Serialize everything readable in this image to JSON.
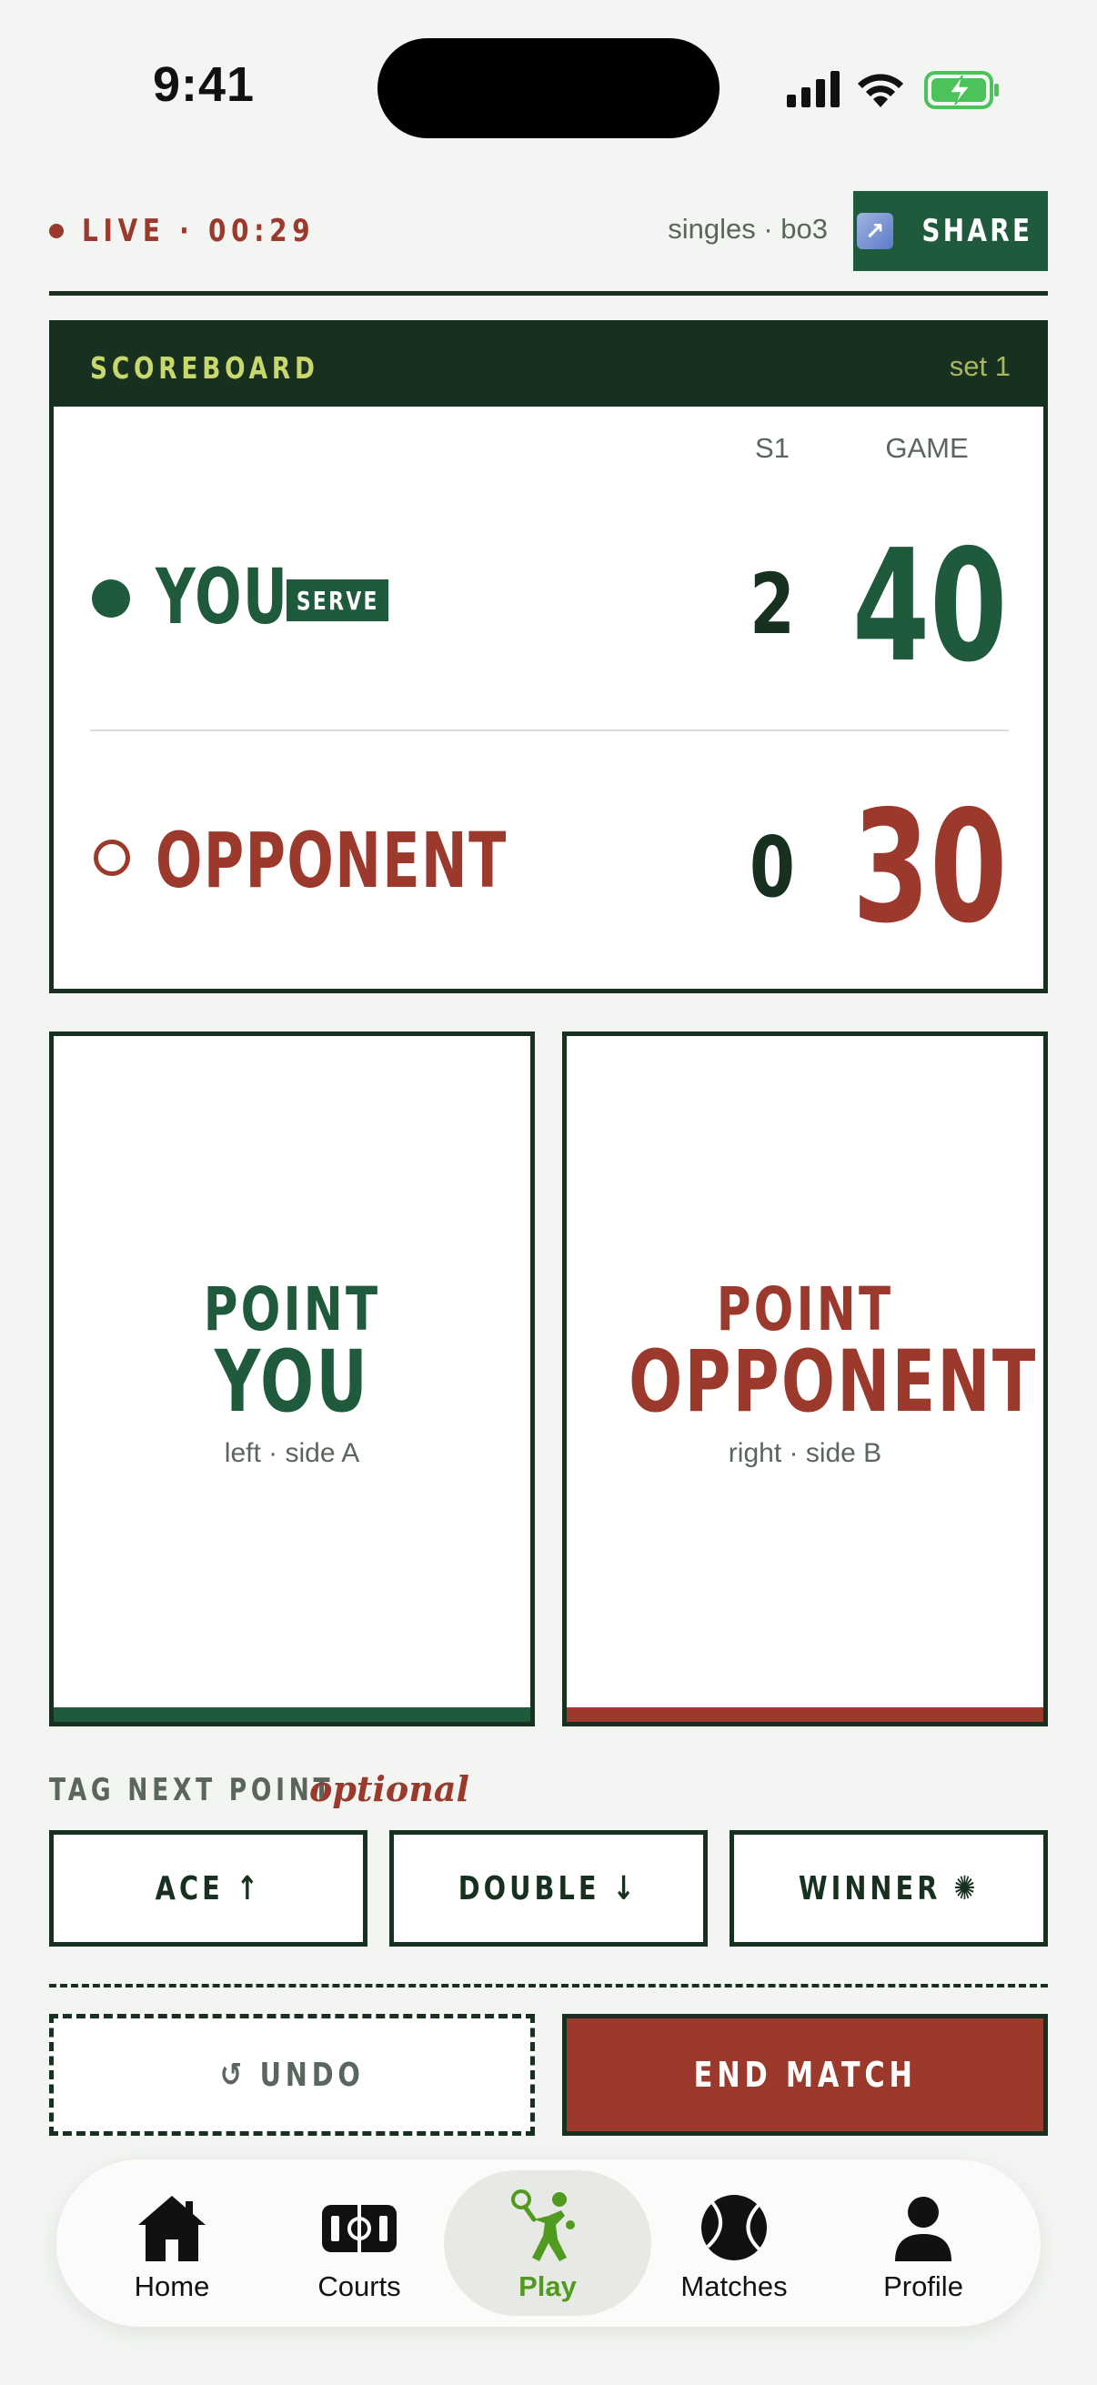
{
  "status_bar": {
    "time": "9:41"
  },
  "header": {
    "live_label": "LIVE · 00:29",
    "mode": "singles · bo3",
    "share_label": "SHARE"
  },
  "scoreboard": {
    "title": "SCOREBOARD",
    "set": "set 1",
    "col_set": "S1",
    "col_game": "GAME",
    "players": [
      {
        "name": "YOU",
        "serve_badge": "SERVE",
        "set_score": "2",
        "game_score": "40",
        "serving": true
      },
      {
        "name": "OPPONENT",
        "set_score": "0",
        "game_score": "30",
        "serving": false
      }
    ]
  },
  "point_cards": [
    {
      "top": "POINT",
      "name": "YOU",
      "side": "left · side A"
    },
    {
      "top": "POINT",
      "name": "OPPONENT",
      "side": "right · side B"
    }
  ],
  "tags": {
    "label": "TAG NEXT POINT",
    "optional": "optional",
    "buttons": [
      {
        "label": "ACE ↑"
      },
      {
        "label": "DOUBLE ↓"
      },
      {
        "label": "WINNER ✺"
      }
    ]
  },
  "actions": {
    "undo": "↺ UNDO",
    "end": "END MATCH"
  },
  "tabbar": {
    "items": [
      {
        "label": "Home",
        "icon": "home-icon"
      },
      {
        "label": "Courts",
        "icon": "court-icon"
      },
      {
        "label": "Play",
        "icon": "tennis-player-icon",
        "active": true
      },
      {
        "label": "Matches",
        "icon": "tennis-ball-icon"
      },
      {
        "label": "Profile",
        "icon": "person-icon"
      }
    ]
  },
  "colors": {
    "green": "#1f5a3c",
    "dark": "#17301f",
    "red": "#9b3a2c",
    "accent_yellow": "#c9d86a",
    "active_tab": "#4f9a1f"
  }
}
